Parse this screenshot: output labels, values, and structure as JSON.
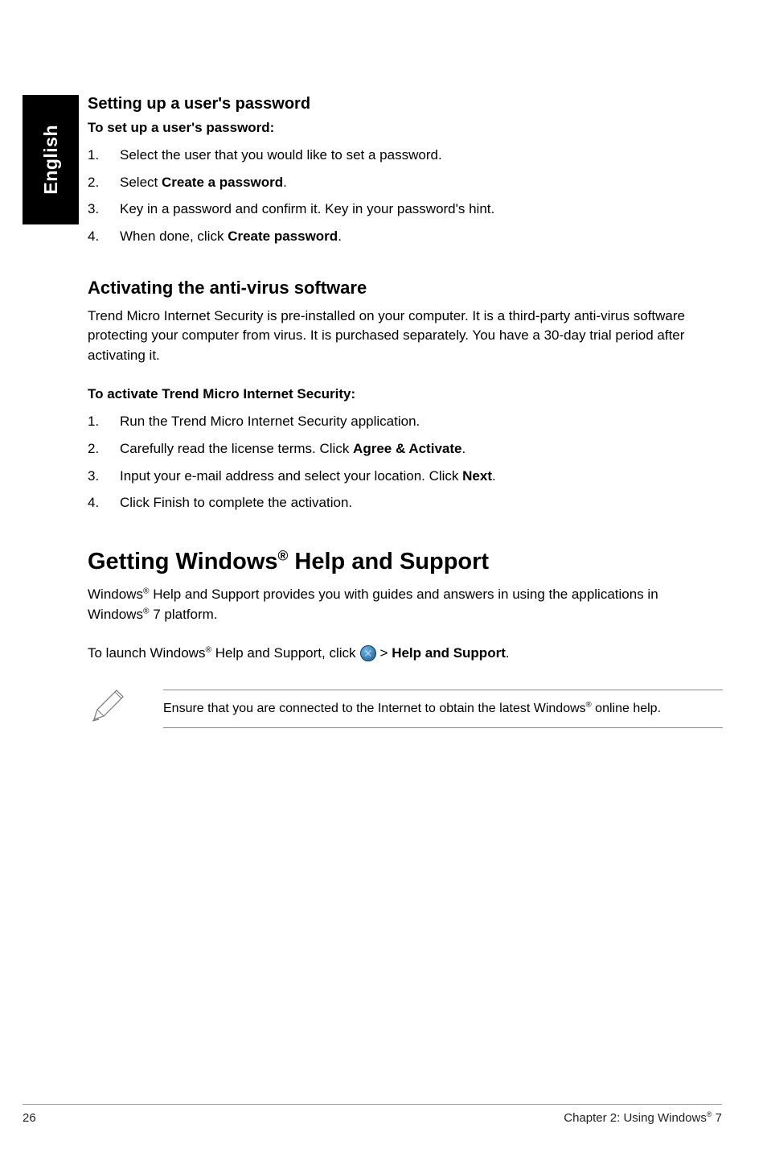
{
  "sideTab": "English",
  "section1": {
    "heading": "Setting up a user's password",
    "subheading": "To set up a user's password:",
    "items": [
      {
        "num": "1.",
        "text": "Select the user that you would like to set a password."
      },
      {
        "num": "2.",
        "pre": "Select ",
        "bold": "Create a password",
        "post": "."
      },
      {
        "num": "3.",
        "text": "Key in a password and confirm it. Key in your password's hint."
      },
      {
        "num": "4.",
        "pre": "When done, click ",
        "bold": "Create password",
        "post": "."
      }
    ]
  },
  "section2": {
    "heading": "Activating the anti-virus software",
    "intro": "Trend Micro Internet Security is pre-installed on your computer. It is a third-party anti-virus software protecting your computer from virus. It is purchased separately. You have a 30-day trial period after activating it.",
    "subheading": "To activate Trend Micro Internet Security:",
    "items": [
      {
        "num": "1.",
        "text": "Run the Trend Micro Internet Security application."
      },
      {
        "num": "2.",
        "pre": "Carefully read the license terms. Click ",
        "bold": "Agree & Activate",
        "post": "."
      },
      {
        "num": "3.",
        "pre": "Input your e-mail address and select your location. Click ",
        "bold": "Next",
        "post": "."
      },
      {
        "num": "4.",
        "text": "Click Finish to complete the activation."
      }
    ]
  },
  "section3": {
    "heading_pre": "Getting Windows",
    "heading_sup": "®",
    "heading_post": " Help and Support",
    "intro_pre": "Windows",
    "intro_sup1": "®",
    "intro_mid": " Help and Support provides you with guides and answers in using the applications in Windows",
    "intro_sup2": "®",
    "intro_post": " 7 platform.",
    "launch_pre": "To launch Windows",
    "launch_sup": "®",
    "launch_mid": " Help and Support, click ",
    "launch_gt": " > ",
    "launch_bold": "Help and Support",
    "launch_post": ".",
    "note_pre": "Ensure that you are connected to the Internet to obtain the latest Windows",
    "note_sup": "®",
    "note_post": " online help."
  },
  "footer": {
    "pageNum": "26",
    "chapter_pre": "Chapter 2: Using Windows",
    "chapter_sup": "®",
    "chapter_post": " 7"
  }
}
